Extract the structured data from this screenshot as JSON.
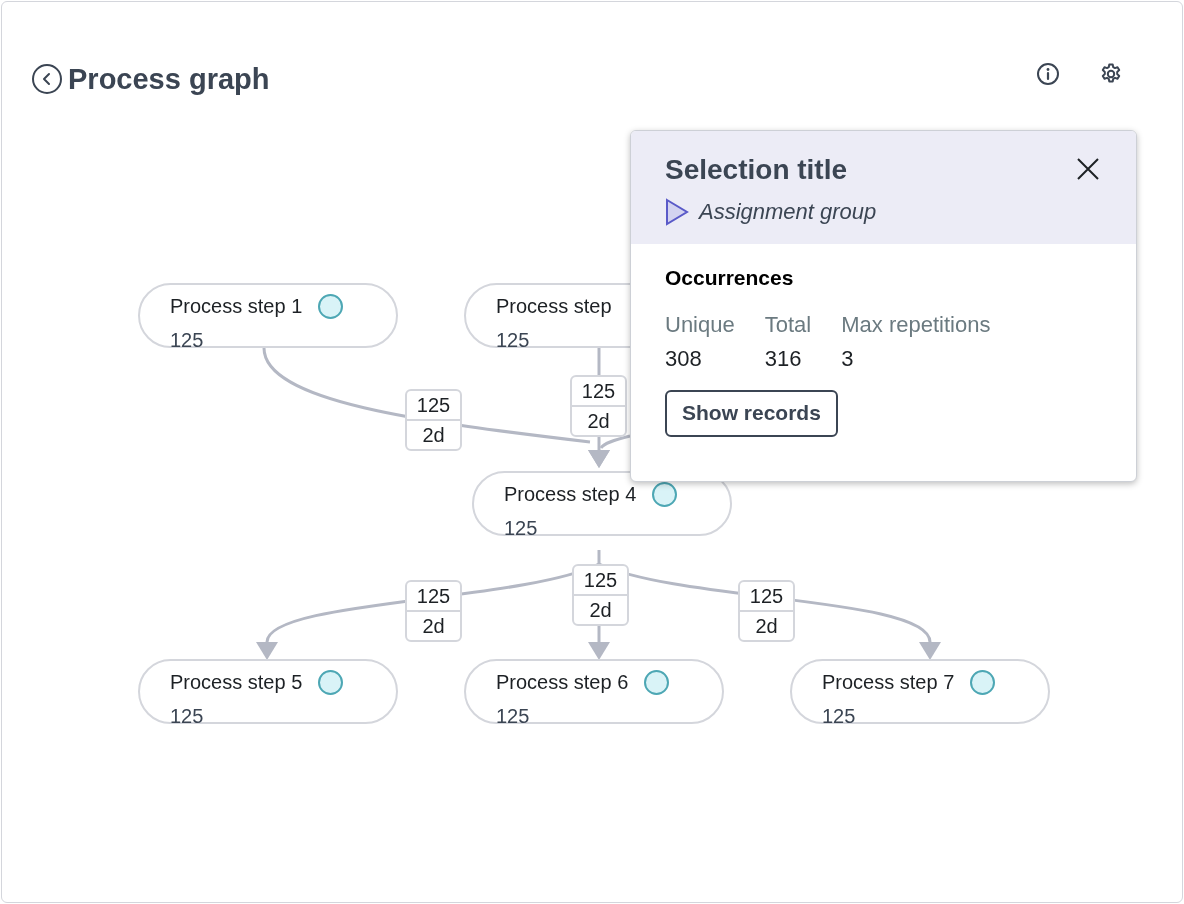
{
  "title": "Process graph",
  "nodes": [
    {
      "title": "Process step 1",
      "count": "125",
      "indicator": true
    },
    {
      "title": "Process step",
      "count": "125",
      "indicator": false
    },
    {
      "title": "Process step 4",
      "count": "125",
      "indicator": true
    },
    {
      "title": "Process step 5",
      "count": "125",
      "indicator": true
    },
    {
      "title": "Process step 6",
      "count": "125",
      "indicator": true
    },
    {
      "title": "Process step 7",
      "count": "125",
      "indicator": true
    }
  ],
  "edges": [
    {
      "count": "125",
      "duration": "2d"
    },
    {
      "count": "125",
      "duration": "2d"
    },
    {
      "count": "125",
      "duration": "2d"
    },
    {
      "count": "125",
      "duration": "2d"
    },
    {
      "count": "125",
      "duration": "2d"
    }
  ],
  "popup": {
    "title": "Selection title",
    "subtitle": "Assignment group",
    "section": "Occurrences",
    "stats": [
      {
        "label": "Unique",
        "value": "308"
      },
      {
        "label": "Total",
        "value": "316"
      },
      {
        "label": "Max repetitions",
        "value": "3"
      }
    ],
    "button": "Show records"
  }
}
